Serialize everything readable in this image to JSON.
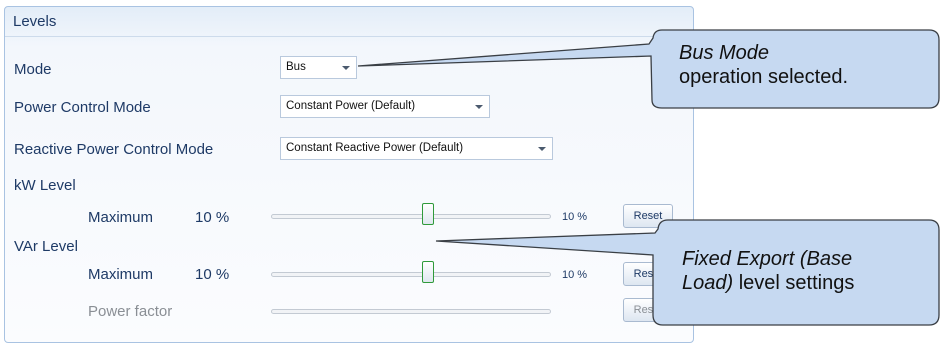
{
  "panel": {
    "title": "Levels"
  },
  "mode": {
    "label": "Mode",
    "value": "Bus"
  },
  "power_control": {
    "label": "Power Control Mode",
    "value": "Constant Power (Default)"
  },
  "reactive_control": {
    "label": "Reactive Power Control Mode",
    "value": "Constant Reactive Power (Default)"
  },
  "kw_level": {
    "label": "kW Level",
    "max_label": "Maximum",
    "max_value": "10 %",
    "slider_text": "10 %",
    "slider_fraction": 0.56,
    "reset_label": "Reset"
  },
  "var_level": {
    "label": "VAr Level",
    "max_label": "Maximum",
    "max_value": "10 %",
    "slider_text": "10 %",
    "slider_fraction": 0.56,
    "reset_label": "Reset"
  },
  "power_factor": {
    "label": "Power factor",
    "reset_label": "Reset"
  },
  "callout_bus": {
    "italic": "Bus Mode",
    "rest": "operation selected."
  },
  "callout_export": {
    "italic": "Fixed Export (Base",
    "italic2": "Load)",
    "rest": " level settings"
  }
}
